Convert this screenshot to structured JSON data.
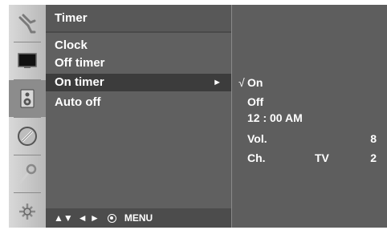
{
  "icons": [
    "antenna-icon",
    "picture-icon",
    "speaker-icon",
    "clock-icon",
    "wrench-icon",
    "connector-icon"
  ],
  "menu": {
    "title": "Timer",
    "items": [
      {
        "label": "Clock"
      },
      {
        "label": "Off timer"
      },
      {
        "label": "On timer",
        "arrow": "►"
      },
      {
        "label": "Auto off"
      }
    ],
    "footer": {
      "updown": "▲▼",
      "leftright": "◄ ►",
      "menu": "MENU"
    }
  },
  "submenu": {
    "check": "√",
    "on": "On",
    "off": "Off",
    "time": "12 : 00 AM",
    "vol_label": "Vol.",
    "vol_value": "8",
    "ch_label": "Ch.",
    "ch_source": "TV",
    "ch_value": "2"
  },
  "colors": {
    "background": "#bfbfbf",
    "menu": "#606060",
    "highlight": "#3c3c3c",
    "text": "#ffffff"
  }
}
